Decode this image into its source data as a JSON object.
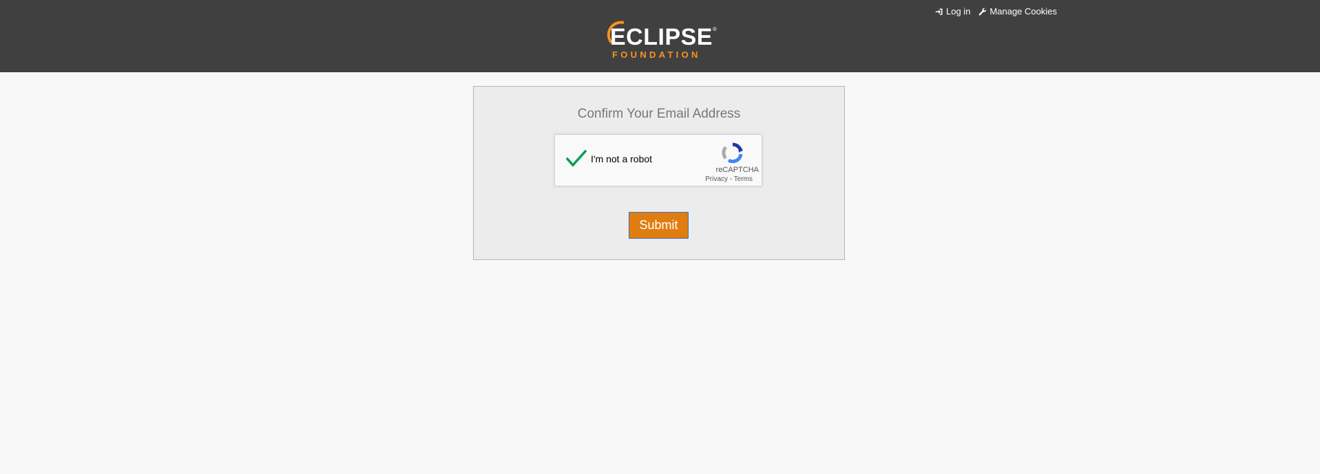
{
  "header": {
    "login_label": "Log in",
    "login_icon": "sign-in-icon",
    "cookies_label": "Manage Cookies",
    "cookies_icon": "wrench-icon",
    "logo": {
      "word": "ECLIPSE",
      "registered": "®",
      "sub": "FOUNDATION"
    }
  },
  "form": {
    "title": "Confirm Your Email Address",
    "captcha": {
      "label": "I'm not a robot",
      "checked": true,
      "brand": "reCAPTCHA",
      "privacy": "Privacy",
      "separator": " - ",
      "terms": "Terms"
    },
    "submit_label": "Submit"
  },
  "colors": {
    "header_bg": "#404040",
    "page_bg": "#f8f8f8",
    "card_bg": "#ececec",
    "accent_orange": "#e07d10",
    "check_green": "#009f55"
  }
}
